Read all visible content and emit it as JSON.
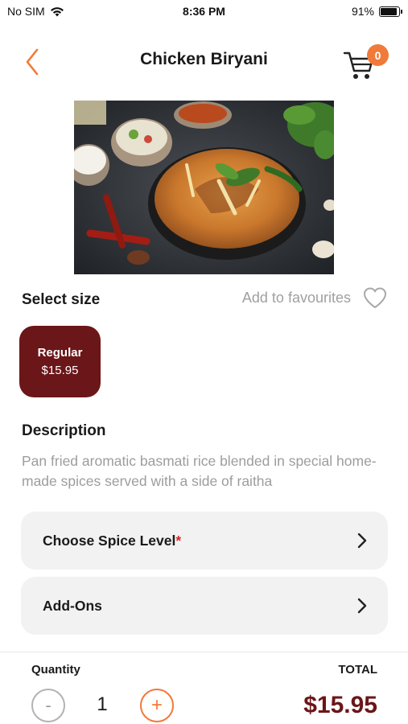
{
  "status_bar": {
    "carrier": "No SIM",
    "time": "8:36 PM",
    "battery": "91%",
    "battery_level": 0.91
  },
  "header": {
    "title": "Chicken Biryani",
    "back_icon": "chevron-left-icon",
    "cart_icon": "cart-icon",
    "cart_count": "0"
  },
  "product": {
    "image_icon": "biryani-photo"
  },
  "size_section": {
    "label": "Select size",
    "favourites_label": "Add to favourites",
    "sizes": [
      {
        "name": "Regular",
        "price": "$15.95",
        "selected": true
      }
    ]
  },
  "description": {
    "title": "Description",
    "text": "Pan fried aromatic basmati rice blended in special home-made spices served with a side of raitha"
  },
  "options": [
    {
      "label": "Choose Spice Level",
      "required_mark": "*"
    },
    {
      "label": "Add-Ons",
      "required_mark": ""
    }
  ],
  "footer": {
    "quantity_label": "Quantity",
    "quantity": "1",
    "minus_label": "-",
    "plus_label": "+",
    "total_label": "TOTAL",
    "total": "$15.95"
  },
  "colors": {
    "accent": "#f07a3a",
    "brand": "#6b1618",
    "card_bg": "#f2f2f2",
    "muted_text": "#9d9d9d"
  }
}
